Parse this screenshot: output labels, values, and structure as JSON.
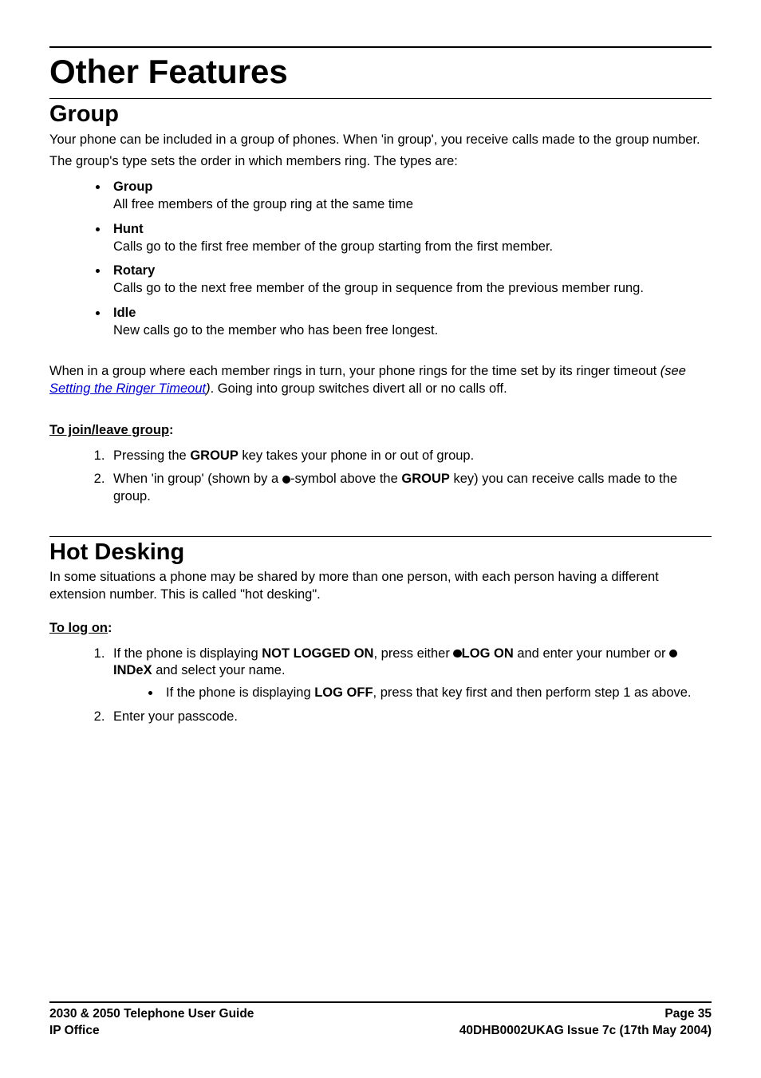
{
  "chapter_title": "Other Features",
  "section1": {
    "title": "Group",
    "intro1": "Your phone can be included in a group of phones. When 'in group', you receive calls made to the group number.",
    "intro2": "The group's type sets the order in which members ring. The types are:",
    "types": [
      {
        "term": "Group",
        "desc": "All free members of the group ring at the same time"
      },
      {
        "term": "Hunt",
        "desc": "Calls go to the first free member of the group starting from the first member."
      },
      {
        "term": "Rotary",
        "desc": "Calls go to the next free member of the group in sequence from the previous member rung."
      },
      {
        "term": "Idle",
        "desc": "New calls go to the member who has been free longest."
      }
    ],
    "note_pre": "When in a group where each member rings in turn, your phone rings for the time set by its ringer timeout ",
    "note_italic_pre": "(see ",
    "note_link": "Setting the Ringer Timeout",
    "note_italic_post": ")",
    "note_post": ". Going into group switches divert all or no calls off.",
    "sub_join": "To join/leave group",
    "step1_pre": "Pressing the ",
    "step1_bold": "GROUP",
    "step1_post": " key takes your phone in or out of group.",
    "step2_pre": "When 'in group' (shown by a ",
    "step2_mid": "-symbol above the ",
    "step2_bold": "GROUP",
    "step2_post": " key) you can receive calls made to the group."
  },
  "section2": {
    "title": "Hot Desking",
    "intro": "In some situations a phone may be shared by more than one person, with each person having a different extension number. This is called \"hot desking\".",
    "sub_logon": "To log on",
    "s1_a": "If the phone is displaying ",
    "s1_b": "NOT LOGGED ON",
    "s1_c": ", press either ",
    "s1_d": "LOG ON",
    "s1_e": " and enter your number or ",
    "s1_f": "INDeX",
    "s1_g": " and select your name.",
    "s1_inner_a": "If the phone is displaying ",
    "s1_inner_b": "LOG OFF",
    "s1_inner_c": ", press that key first and then perform step 1 as above.",
    "s2": "Enter your passcode."
  },
  "footer": {
    "l1l": "2030 & 2050 Telephone User Guide",
    "l1r": "Page 35",
    "l2l": "IP Office",
    "l2r": "40DHB0002UKAG Issue 7c (17th May 2004)"
  }
}
